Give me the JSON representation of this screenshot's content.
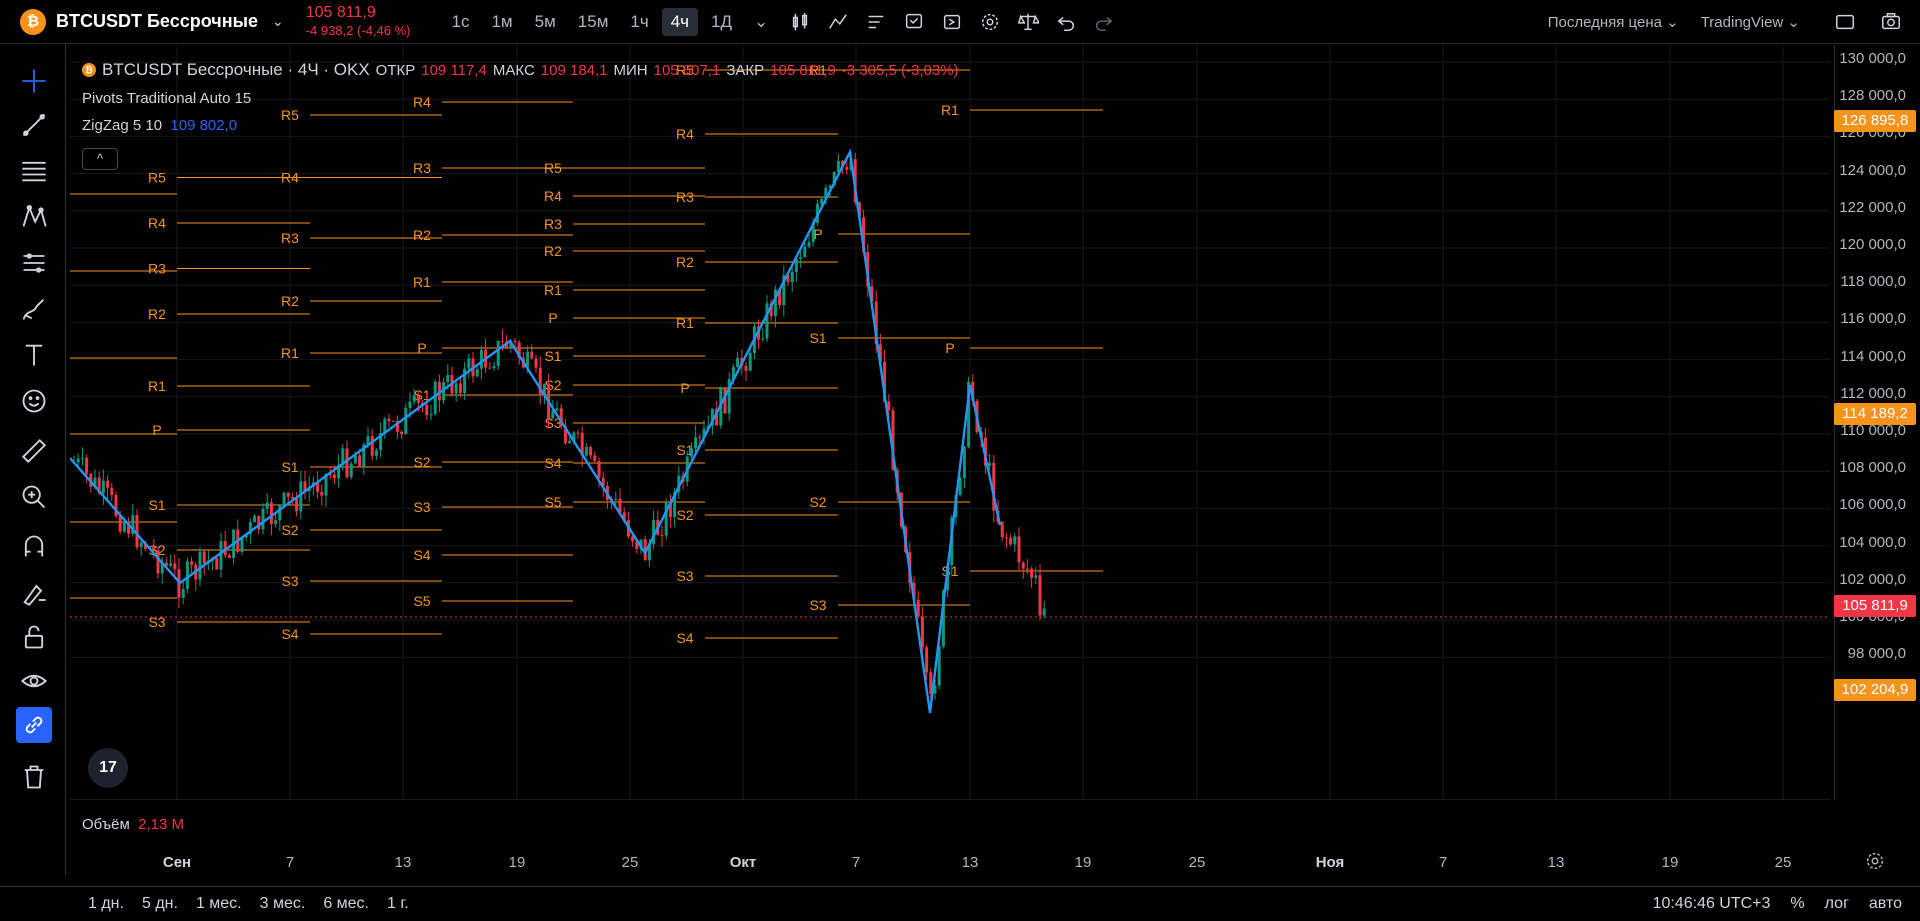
{
  "header": {
    "coin_glyph": "₿",
    "symbol": "BTCUSDT Бессрочные",
    "last_price": "105 811,9",
    "change": "-4 938,2 (-4,46 %)",
    "timeframes": [
      "1с",
      "1м",
      "5м",
      "15м",
      "1ч",
      "4ч",
      "1Д"
    ],
    "active_timeframe": "4ч",
    "price_type": "Последняя цена",
    "data_source": "TradingView"
  },
  "legend": {
    "title": "BTCUSDT Бессрочные · 4Ч · OKX",
    "open_label": "ОТКР",
    "open": "109 117,4",
    "high_label": "МАКС",
    "high": "109 184,1",
    "low_label": "МИН",
    "low": "105 607,1",
    "close_label": "ЗАКР",
    "close": "105 811,9",
    "change": "-3 305,5 (-3,03%)",
    "indicator1": "Pivots Traditional Auto 15",
    "indicator2_name": "ZigZag 5 10",
    "indicator2_value": "109 802,0",
    "collapse_glyph": "^"
  },
  "volume": {
    "label": "Объём",
    "value": "2,13 M"
  },
  "price_axis": {
    "ticks": [
      "130 000,0",
      "128 000,0",
      "126 000,0",
      "124 000,0",
      "122 000,0",
      "120 000,0",
      "118 000,0",
      "116 000,0",
      "114 000,0",
      "112 000,0",
      "110 000,0",
      "108 000,0",
      "106 000,0",
      "104 000,0",
      "102 000,0",
      "100 000,0",
      "98 000,0"
    ],
    "labels": [
      {
        "text": "126 895,8",
        "color": "#f7931a"
      },
      {
        "text": "114 189,2",
        "color": "#f7931a"
      },
      {
        "text": "105 811,9",
        "color": "#f23645"
      },
      {
        "text": "102 204,9",
        "color": "#f7931a"
      }
    ]
  },
  "time_axis": [
    "Сен",
    "7",
    "13",
    "19",
    "25",
    "Окт",
    "7",
    "13",
    "19",
    "25",
    "Ноя",
    "7",
    "13",
    "19",
    "25"
  ],
  "ranges": [
    "1 дн.",
    "5 дн.",
    "1 мес.",
    "3 мес.",
    "6 мес.",
    "1 г."
  ],
  "status": {
    "clock": "10:46:46 UTC+3",
    "percent": "%",
    "log": "лог",
    "auto": "авто"
  },
  "logo": "17",
  "colors": {
    "up": "#089981",
    "down": "#f23645",
    "pivot": "#f7931a",
    "zigzag": "#2196f3"
  },
  "pivots": [
    {
      "levels": [
        [
          "R5",
          177.5
        ],
        [
          "R4",
          223
        ],
        [
          "R3",
          268.5
        ],
        [
          "R2",
          314
        ],
        [
          "R1",
          386
        ],
        [
          "P",
          430
        ],
        [
          "S1",
          505
        ],
        [
          "S2",
          550
        ],
        [
          "S3",
          622
        ]
      ]
    },
    {
      "levels": [
        [
          "R5",
          115
        ],
        [
          "R4",
          177.5
        ],
        [
          "R3",
          238
        ],
        [
          "R2",
          301
        ],
        [
          "R1",
          353
        ],
        [
          "S1",
          467
        ],
        [
          "S2",
          530
        ],
        [
          "S3",
          581
        ],
        [
          "S4",
          634
        ]
      ]
    },
    {
      "levels": [
        [
          "R4",
          102
        ],
        [
          "R3",
          168
        ],
        [
          "R2",
          235
        ],
        [
          "R1",
          282
        ],
        [
          "P",
          348
        ],
        [
          "S1",
          395
        ],
        [
          "S2",
          462
        ],
        [
          "S3",
          507
        ],
        [
          "S4",
          555
        ],
        [
          "S5",
          601
        ]
      ]
    },
    {
      "levels": [
        [
          "R5",
          168
        ],
        [
          "R4",
          196
        ],
        [
          "R3",
          224
        ],
        [
          "R2",
          251
        ],
        [
          "R1",
          290
        ],
        [
          "P",
          318
        ],
        [
          "S1",
          356
        ],
        [
          "S2",
          385
        ],
        [
          "S3",
          423
        ],
        [
          "S4",
          463
        ],
        [
          "S5",
          502
        ]
      ]
    },
    {
      "levels": [
        [
          "R5",
          70
        ],
        [
          "R4",
          134
        ],
        [
          "R3",
          197
        ],
        [
          "R2",
          262
        ],
        [
          "R1",
          323
        ],
        [
          "P",
          388
        ],
        [
          "S1",
          450
        ],
        [
          "S2",
          515
        ],
        [
          "S3",
          576
        ],
        [
          "S4",
          638
        ]
      ]
    },
    {
      "levels": [
        [
          "R1",
          70
        ],
        [
          "P",
          234
        ],
        [
          "S1",
          338
        ],
        [
          "S2",
          502
        ],
        [
          "S3",
          605
        ]
      ]
    },
    {
      "levels": [
        [
          "R1",
          110
        ],
        [
          "P",
          348
        ],
        [
          "S1",
          571
        ]
      ]
    }
  ]
}
